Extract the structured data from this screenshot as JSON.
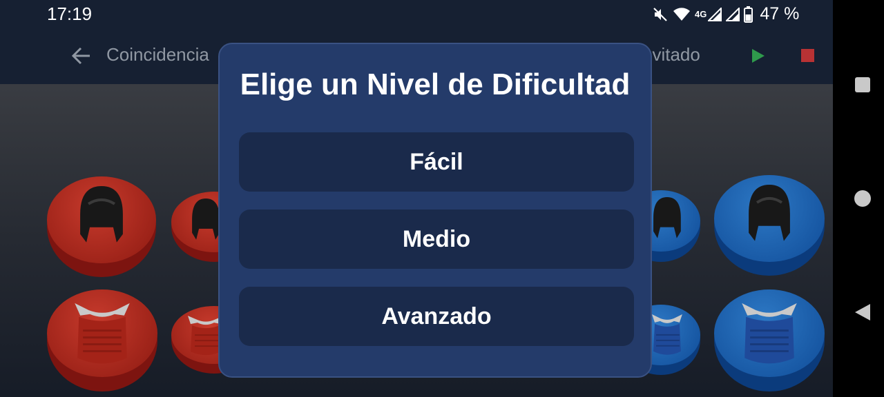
{
  "status_bar": {
    "time": "17:19",
    "network": "4G",
    "battery": "47 %"
  },
  "app_bar": {
    "title": "Coincidencia",
    "guest": "nvitado"
  },
  "dialog": {
    "title": "Elige un Nivel de Dificultad",
    "options": [
      {
        "label": "Fácil"
      },
      {
        "label": "Medio"
      },
      {
        "label": "Avanzado"
      }
    ]
  },
  "colors": {
    "red": "#b82a1e",
    "blue": "#1f67b6",
    "dialog": "#243b6a",
    "option": "#1a2a4b",
    "play": "#2f9a4c",
    "stop": "#b83234"
  },
  "icons": [
    "mute-icon",
    "wifi-icon",
    "signal-icon",
    "battery-icon",
    "back-arrow-icon",
    "play-icon",
    "stop-icon",
    "helmet-icon",
    "chest-protector-icon"
  ]
}
